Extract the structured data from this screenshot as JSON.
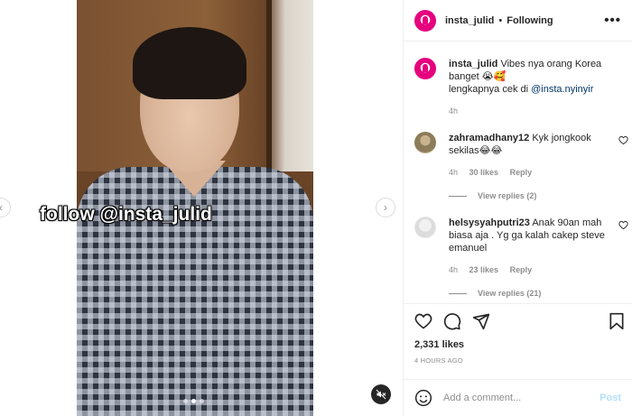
{
  "header": {
    "username": "insta_julid",
    "separator": "•",
    "follow_status": "Following",
    "more_label": "•••"
  },
  "media": {
    "overlay_text": "follow @insta_julid",
    "carousel_count": 3,
    "carousel_active_index": 1
  },
  "caption": {
    "username": "insta_julid",
    "text": "Vibes nya orang Korea banget 😭🥰",
    "line2_prefix": "lengkapnya cek di ",
    "mention": "@insta.nyinyir",
    "time": "4h"
  },
  "comments": [
    {
      "username": "zahramadhany12",
      "text": "Kyk jongkook sekilas😂😂",
      "time": "4h",
      "likes": "30 likes",
      "reply_label": "Reply",
      "view_replies": "View replies (2)"
    },
    {
      "username": "helsysyahputri23",
      "text": "Anak 90an mah biasa aja . Yg ga kalah cakep steve emanuel",
      "time": "4h",
      "likes": "23 likes",
      "reply_label": "Reply",
      "view_replies": "View replies (21)"
    }
  ],
  "actions": {
    "icons": [
      "heart-icon",
      "comment-icon",
      "share-icon",
      "bookmark-icon"
    ],
    "likes": "2,331 likes",
    "posted": "4 HOURS AGO"
  },
  "add_comment": {
    "placeholder": "Add a comment...",
    "post_label": "Post"
  },
  "colors": {
    "brand_pink": "#e6007e",
    "link": "#00376b",
    "muted": "#8e8e8e",
    "post_disabled": "#b2dffc"
  }
}
